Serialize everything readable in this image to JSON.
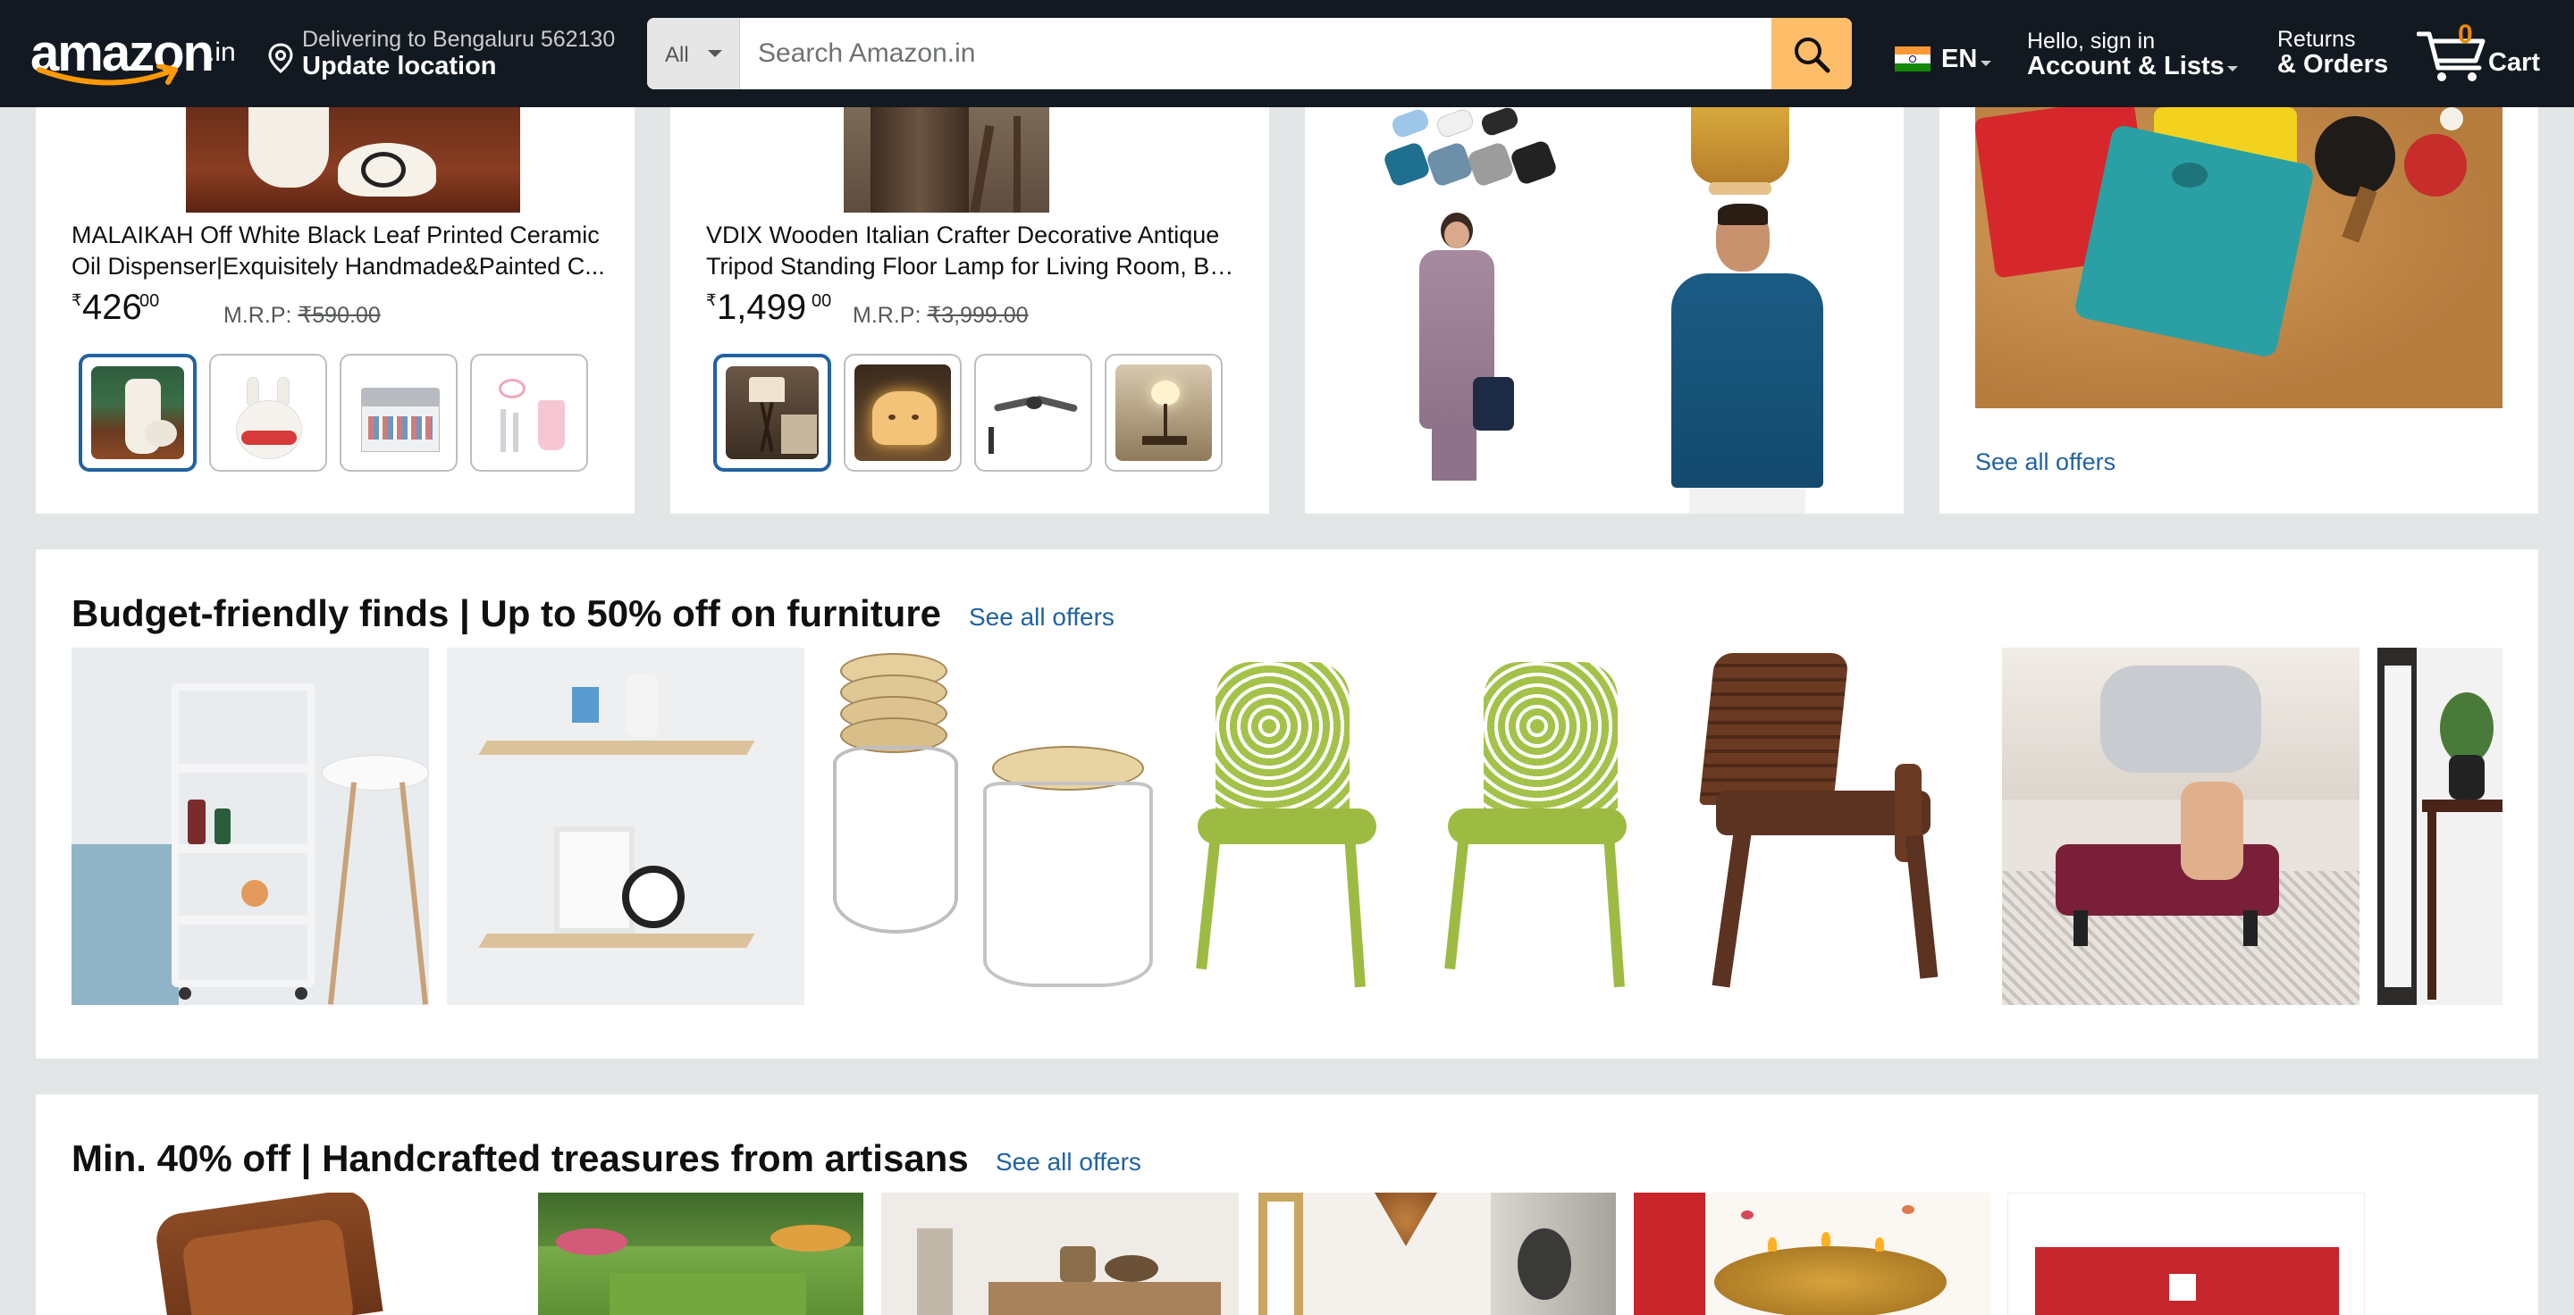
{
  "header": {
    "logo_text": "amazon",
    "logo_tld": ".in",
    "deliver_line1": "Delivering to Bengaluru 562130",
    "deliver_line2": "Update location",
    "search_category": "All",
    "search_placeholder": "Search Amazon.in",
    "language": "EN",
    "account_line1": "Hello, sign in",
    "account_line2": "Account & Lists",
    "orders_line1": "Returns",
    "orders_line2": "& Orders",
    "cart_count": "0",
    "cart_label": "Cart",
    "icons": [
      "location-pin-icon",
      "search-icon",
      "india-flag-icon",
      "cart-icon"
    ]
  },
  "cards": [
    {
      "title_line1": "MALAIKAH Off White Black Leaf Printed Ceramic",
      "title_line2": "Oil Dispenser|Exquisitely Handmade&Painted C...",
      "price_symbol": "₹",
      "price_whole": "426",
      "price_fraction": "00",
      "mrp_label": "M.R.P:",
      "mrp_value": "₹590.00"
    },
    {
      "title_line1": "VDIX Wooden Italian Crafter Decorative Antique",
      "title_line2": "Tripod Standing Floor Lamp for Living Room, Be...",
      "price_symbol": "₹",
      "price_whole": "1,499",
      "price_fraction": "00",
      "mrp_label": "M.R.P:",
      "mrp_value": "₹3,999.00"
    }
  ],
  "offers_card": {
    "link": "See all offers"
  },
  "furniture": {
    "title": "Budget-friendly finds | Up to 50% off on furniture",
    "link": "See all offers"
  },
  "handcrafted": {
    "title": "Min. 40% off | Handcrafted treasures from artisans",
    "link": "See all offers"
  },
  "colors": {
    "nav_bg": "#131921",
    "search_button": "#febd69",
    "link": "#2162a1",
    "cart_count": "#f08804",
    "page_bg": "#e3e6e6"
  }
}
